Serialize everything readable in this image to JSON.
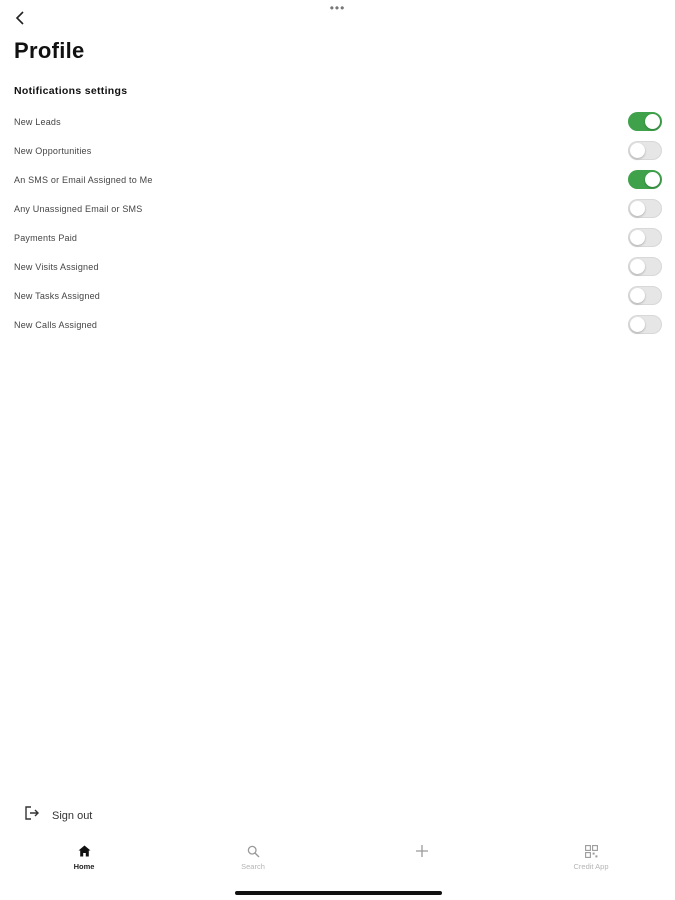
{
  "top_dots": "•••",
  "header": {
    "title": "Profile"
  },
  "notifications": {
    "section_title": "Notifications settings",
    "items": [
      {
        "label": "New Leads",
        "enabled": true
      },
      {
        "label": "New Opportunities",
        "enabled": false
      },
      {
        "label": "An SMS or Email Assigned to Me",
        "enabled": true
      },
      {
        "label": "Any Unassigned Email or SMS",
        "enabled": false
      },
      {
        "label": "Payments Paid",
        "enabled": false
      },
      {
        "label": "New Visits Assigned",
        "enabled": false
      },
      {
        "label": "New Tasks Assigned",
        "enabled": false
      },
      {
        "label": "New Calls Assigned",
        "enabled": false
      }
    ]
  },
  "sign_out": {
    "label": "Sign out",
    "icon": "sign-out-icon"
  },
  "tab_bar": {
    "tabs": [
      {
        "label": "Home",
        "icon": "home-icon",
        "active": true
      },
      {
        "label": "Search",
        "icon": "search-icon",
        "active": false
      },
      {
        "label": "",
        "icon": "plus-icon",
        "active": false
      },
      {
        "label": "Credit App",
        "icon": "qr-code-icon",
        "active": false
      }
    ]
  },
  "colors": {
    "toggle_on": "#3fa24a",
    "toggle_off": "#e6e6e6",
    "text": "#111111"
  }
}
